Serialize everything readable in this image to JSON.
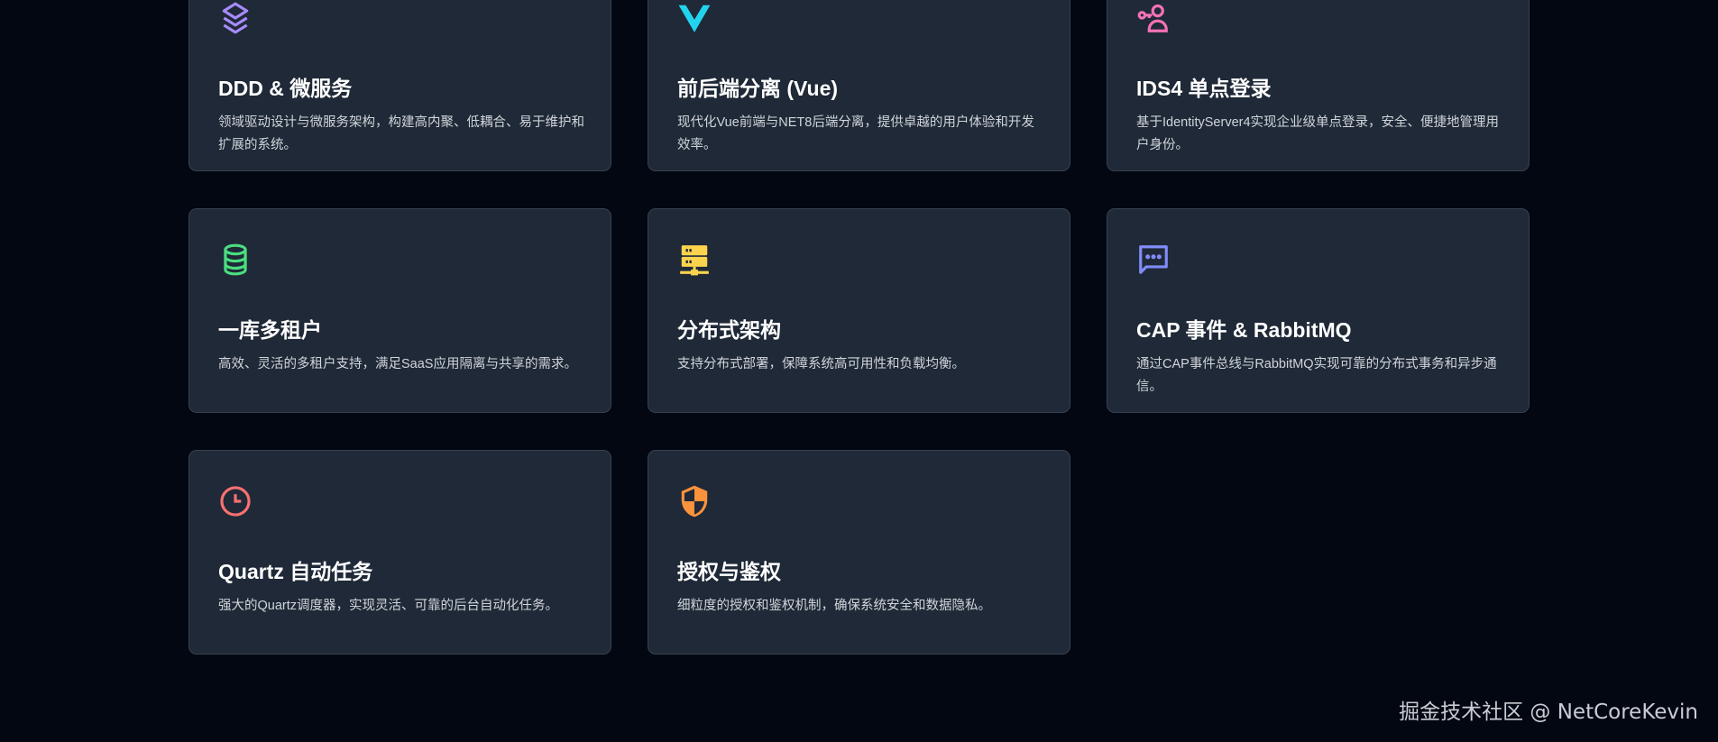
{
  "features": [
    {
      "icon": "layers-icon",
      "color": "#a78bfa",
      "title": "DDD & 微服务",
      "desc": "领域驱动设计与微服务架构，构建高内聚、低耦合、易于维护和扩展的系统。"
    },
    {
      "icon": "vue-logo-icon",
      "color": "#22d3ee",
      "title": "前后端分离 (Vue)",
      "desc": "现代化Vue前端与NET8后端分离，提供卓越的用户体验和开发效率。"
    },
    {
      "icon": "user-key-icon",
      "color": "#f472b6",
      "title": "IDS4 单点登录",
      "desc": "基于IdentityServer4实现企业级单点登录，安全、便捷地管理用户身份。"
    },
    {
      "icon": "database-icon",
      "color": "#4ade80",
      "title": "一库多租户",
      "desc": "高效、灵活的多租户支持，满足SaaS应用隔离与共享的需求。"
    },
    {
      "icon": "server-network-icon",
      "color": "#fcd34d",
      "title": "分布式架构",
      "desc": "支持分布式部署，保障系统高可用性和负载均衡。"
    },
    {
      "icon": "chat-bubble-icon",
      "color": "#818cf8",
      "title": "CAP 事件 & RabbitMQ",
      "desc": "通过CAP事件总线与RabbitMQ实现可靠的分布式事务和异步通信。"
    },
    {
      "icon": "clock-icon",
      "color": "#f87171",
      "title": "Quartz 自动任务",
      "desc": "强大的Quartz调度器，实现灵活、可靠的后台自动化任务。"
    },
    {
      "icon": "shield-icon",
      "color": "#fb923c",
      "title": "授权与鉴权",
      "desc": "细粒度的授权和鉴权机制，确保系统安全和数据隐私。"
    }
  ],
  "watermark": "掘金技术社区 @ NetCoreKevin"
}
